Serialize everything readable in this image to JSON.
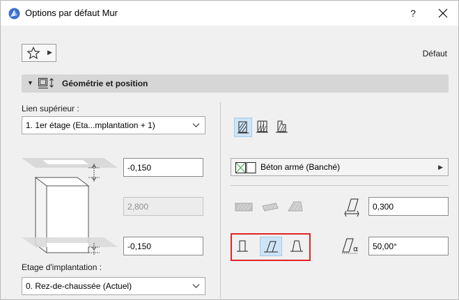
{
  "window": {
    "title": "Options par défaut Mur",
    "help_label": "?",
    "close_label": "✕"
  },
  "toolbar": {
    "favorites_icon": "star-icon",
    "defaut_label": "Défaut"
  },
  "section": {
    "title": "Géométrie et position",
    "icon": "wall-geometry-icon"
  },
  "geometry": {
    "top_link_label": "Lien supérieur :",
    "top_link_value": "1. 1er étage (Eta...mplantation + 1)",
    "top_offset": "-0,150",
    "height": "2,800",
    "bottom_offset": "-0,150",
    "home_story_label": "Etage d'implantation :",
    "home_story_value": "0. Rez-de-chaussée (Actuel)"
  },
  "structure": {
    "buttons": [
      "basic-structure-icon",
      "composite-structure-icon",
      "profile-structure-icon"
    ],
    "selected_index": 0,
    "material": "Béton armé (Banché)"
  },
  "shape": {
    "disabled_buttons": [
      "surface-hatch-icon",
      "slanted-hatch-icon",
      "profile-hatch-icon"
    ],
    "thickness": "0,300",
    "angle": "50,00°",
    "wall_type_buttons": [
      "straight-wall-icon",
      "slanted-wall-icon",
      "double-slanted-wall-icon"
    ],
    "wall_type_selected_index": 1
  },
  "colors": {
    "selection_fill": "#cde4f7",
    "highlight_border": "#e02424",
    "app_icon": "#3b6fd0"
  }
}
